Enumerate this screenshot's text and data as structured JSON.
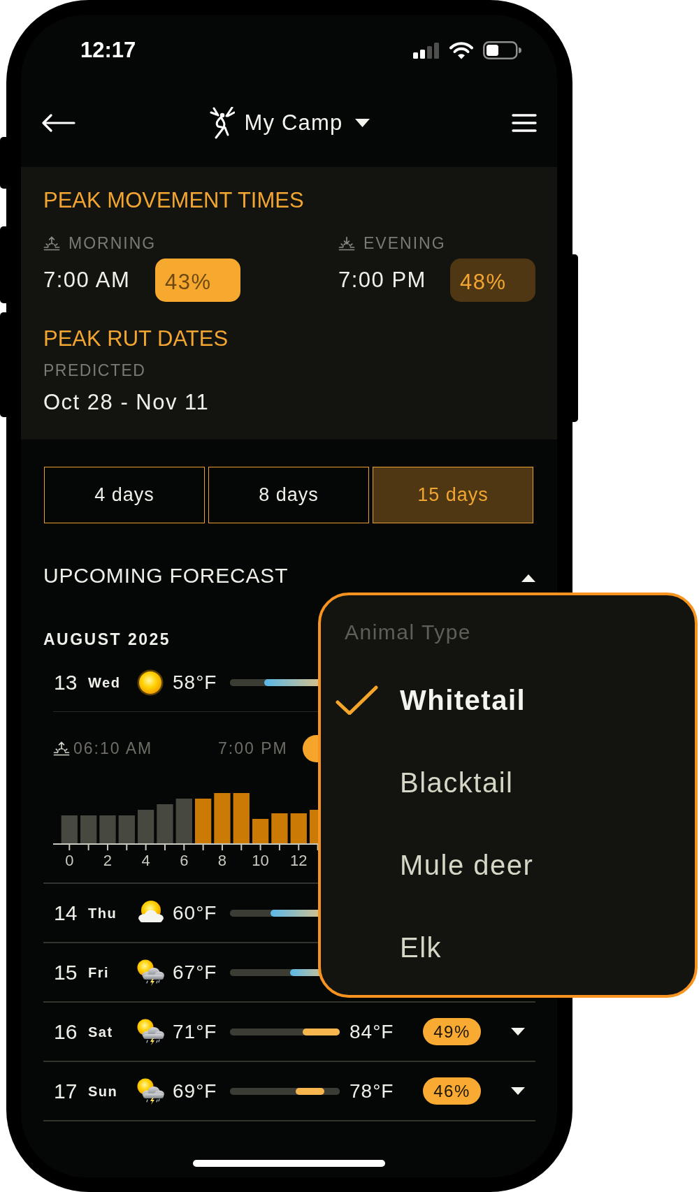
{
  "status_bar": {
    "time": "12:17"
  },
  "nav": {
    "title": "My Camp"
  },
  "peak_movement": {
    "title": "PEAK MOVEMENT TIMES",
    "periods": [
      {
        "kind": "sunrise",
        "label": "MORNING",
        "time": "7:00 AM",
        "percent": "43%",
        "highlighted": true
      },
      {
        "kind": "sunset",
        "label": "EVENING",
        "time": "7:00 PM",
        "percent": "48%",
        "highlighted": false
      }
    ]
  },
  "peak_rut": {
    "title": "PEAK RUT DATES",
    "subtitle": "PREDICTED",
    "dates": "Oct 28 - Nov 11"
  },
  "range_tabs": [
    {
      "label": "4 days",
      "selected": false
    },
    {
      "label": "8 days",
      "selected": false
    },
    {
      "label": "15 days",
      "selected": true
    }
  ],
  "forecast": {
    "title": "UPCOMING FORECAST",
    "expanded": true,
    "month": "AUGUST 2025",
    "days": [
      {
        "date": "13",
        "weekday": "Wed",
        "kind": "sunny",
        "low": "58°F",
        "temp_bar": {
          "before": {
            "level": 0.31
          }
        },
        "expanded": true,
        "details": {
          "sunrise": "06:10 AM",
          "peak_time": "7:00 PM",
          "hour_labels": [
            "0",
            "2",
            "4",
            "6",
            "8",
            "10",
            "12"
          ]
        }
      },
      {
        "date": "14",
        "weekday": "Thu",
        "kind": "cloudy",
        "low": "60°F",
        "temp_bar": {
          "before": {
            "level": 0.37
          }
        }
      },
      {
        "date": "15",
        "weekday": "Fri",
        "kind": "storm",
        "low": "67°F",
        "temp_bar": {
          "before": {
            "level": 0.55
          }
        }
      },
      {
        "date": "16",
        "weekday": "Sat",
        "kind": "storm",
        "low": "71°F",
        "temp_bar": {
          "before": {
            "level": 0.66
          }
        },
        "high": "84°F",
        "percent": "49%",
        "expanded": false
      },
      {
        "date": "17",
        "weekday": "Sun",
        "kind": "storm",
        "low": "69°F",
        "temp_bar": {
          "before": {
            "level": 0.6
          },
          "after": {
            "level": 0.14
          }
        },
        "high": "78°F",
        "percent": "46%",
        "expanded": false
      }
    ]
  },
  "animal_menu": {
    "title": "Animal Type",
    "options": [
      {
        "label": "Whitetail",
        "selected": true
      },
      {
        "label": "Blacktail",
        "selected": false
      },
      {
        "label": "Mule deer",
        "selected": false
      },
      {
        "label": "Elk",
        "selected": false
      }
    ]
  }
}
